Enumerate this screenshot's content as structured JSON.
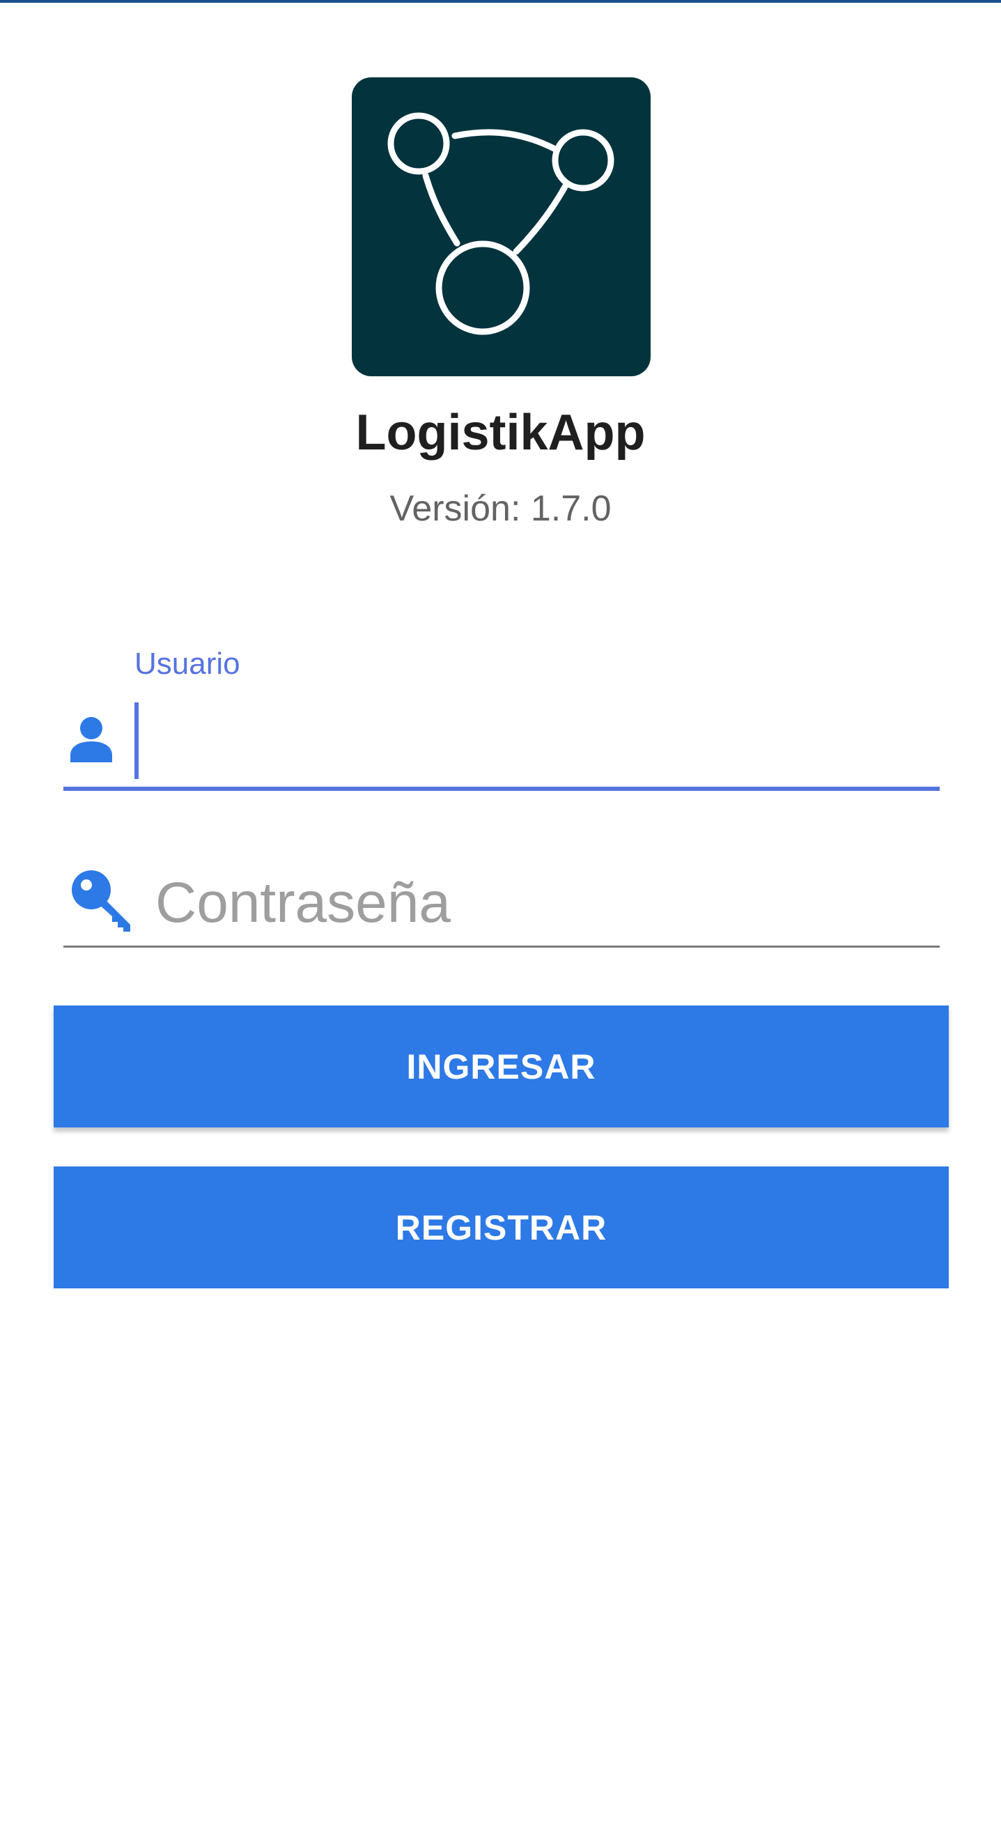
{
  "app": {
    "title": "LogistikApp",
    "version_label": "Versión:",
    "version_value": "1.7.0"
  },
  "form": {
    "username": {
      "label": "Usuario",
      "value": "",
      "icon": "person-icon"
    },
    "password": {
      "placeholder": "Contraseña",
      "value": "",
      "icon": "key-icon"
    }
  },
  "buttons": {
    "login_label": "INGRESAR",
    "register_label": "REGISTRAR"
  },
  "colors": {
    "accent": "#2d79e6",
    "focus": "#5673e0",
    "logo_background": "#03333d",
    "top_bar": "#1a4f8c"
  }
}
